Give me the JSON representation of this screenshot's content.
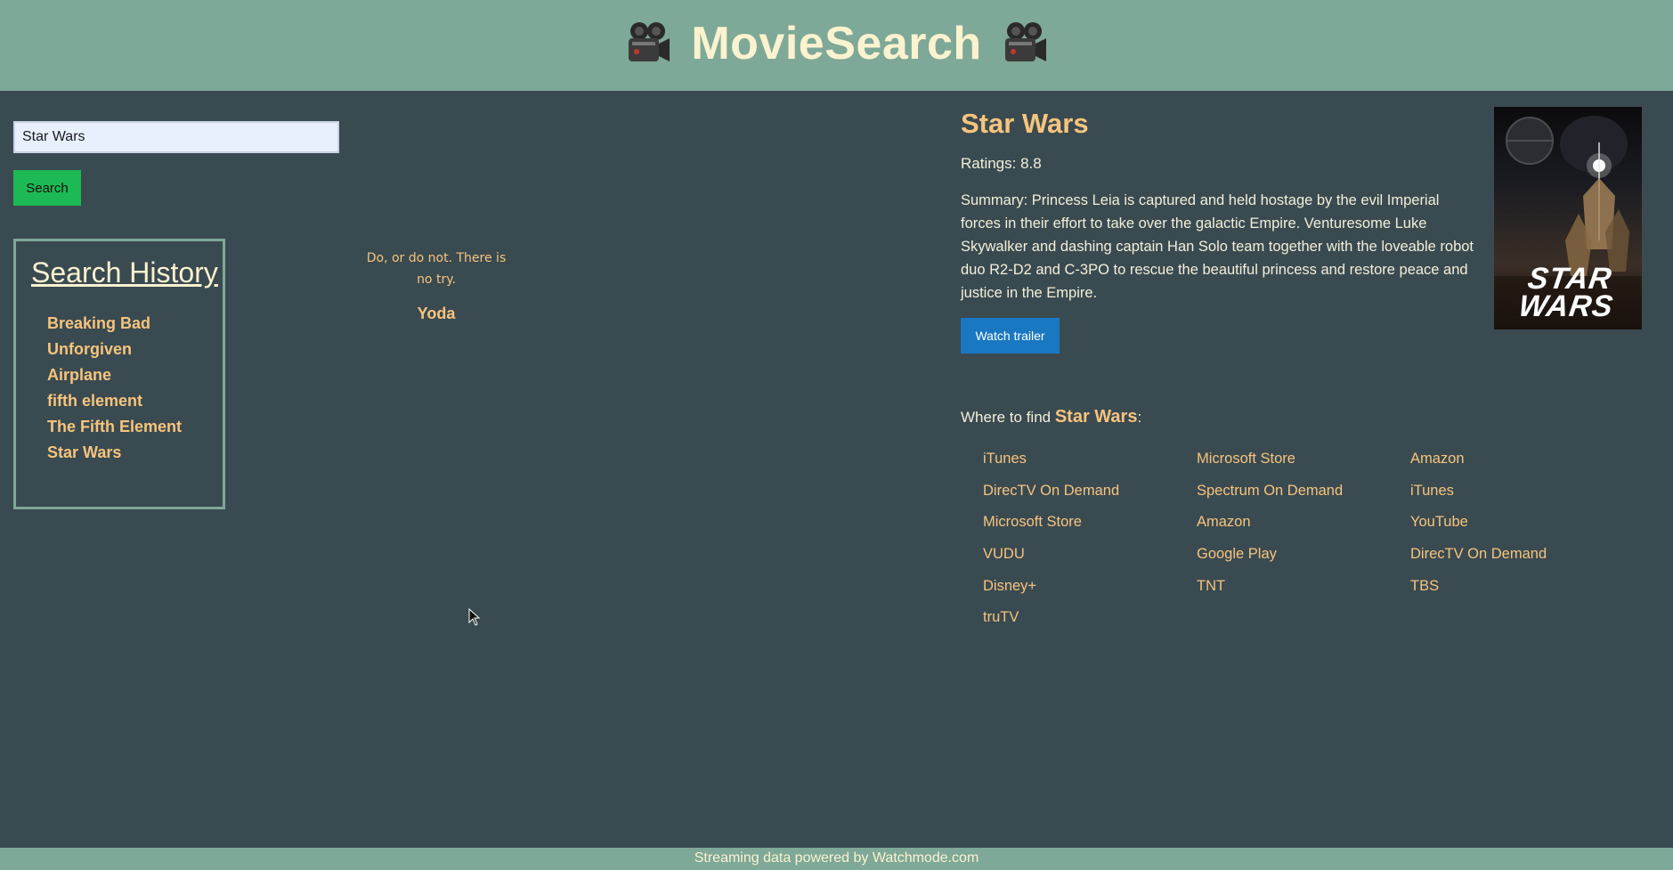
{
  "header": {
    "title": "MovieSearch",
    "icon_left": "movie-camera-icon",
    "icon_right": "movie-camera-icon"
  },
  "search": {
    "value": "Star Wars",
    "button_label": "Search"
  },
  "history": {
    "title": "Search History",
    "items": [
      "Breaking Bad",
      "Unforgiven",
      "Airplane",
      "fifth element",
      "The Fifth Element",
      "Star Wars"
    ]
  },
  "quote": {
    "text": "Do, or do not. There is no try.",
    "author": "Yoda"
  },
  "movie": {
    "title": "Star Wars",
    "ratings": "Ratings: 8.8",
    "summary": "Summary: Princess Leia is captured and held hostage by the evil Imperial forces in their effort to take over the galactic Empire. Venturesome Luke Skywalker and dashing captain Han Solo team together with the loveable robot duo R2-D2 and C-3PO to rescue the beautiful princess and restore peace and justice in the Empire.",
    "trailer_label": "Watch trailer",
    "poster_logo_line1": "STAR",
    "poster_logo_line2": "WARS"
  },
  "where": {
    "prefix": "Where to find ",
    "movie": "Star Wars",
    "suffix": ":",
    "providers": [
      "iTunes",
      "Microsoft Store",
      "Amazon",
      "DirecTV On Demand",
      "Spectrum On Demand",
      "iTunes",
      "Microsoft Store",
      "Amazon",
      "YouTube",
      "VUDU",
      "Google Play",
      "DirecTV On Demand",
      "Disney+",
      "TNT",
      "TBS",
      "truTV"
    ]
  },
  "footer": {
    "text": "Streaming data powered by Watchmode.com"
  },
  "colors": {
    "header": "#7ea897",
    "background": "#3a4a51",
    "accent": "#f6c47d",
    "search_button": "#1db954",
    "trailer_button": "#1a78c2"
  }
}
